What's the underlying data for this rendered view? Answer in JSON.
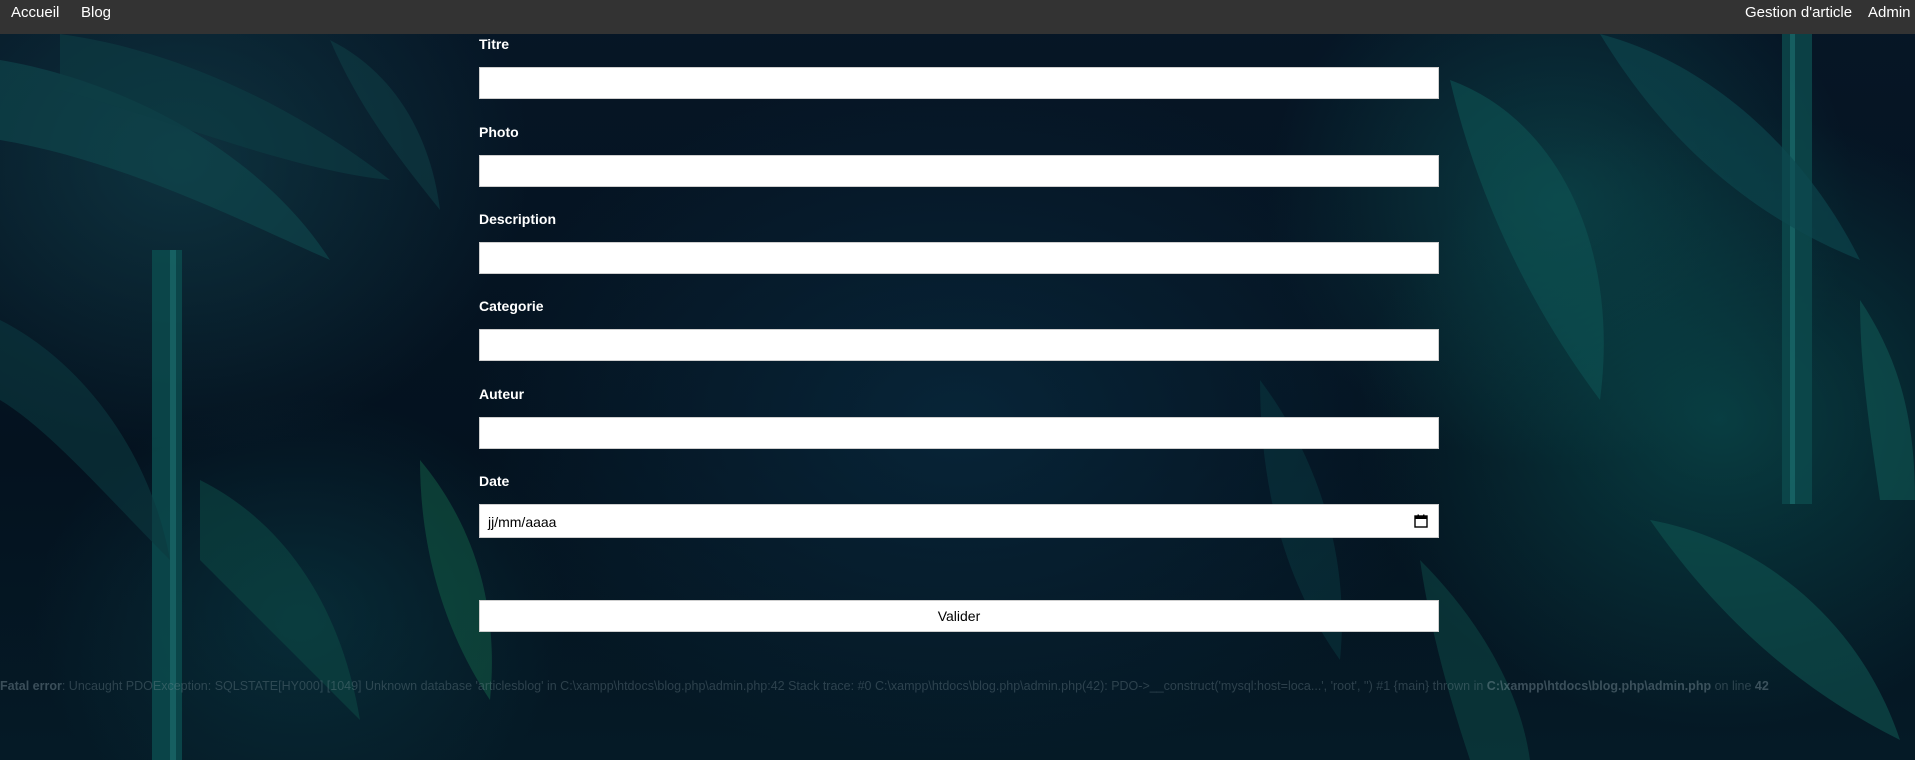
{
  "nav": {
    "left": [
      "Accueil",
      "Blog"
    ],
    "right": [
      "Gestion d'article",
      "Admin"
    ]
  },
  "form": {
    "fields": [
      {
        "label": "Titre",
        "value": ""
      },
      {
        "label": "Photo",
        "value": ""
      },
      {
        "label": "Description",
        "value": ""
      },
      {
        "label": "Categorie",
        "value": ""
      },
      {
        "label": "Auteur",
        "value": ""
      }
    ],
    "date": {
      "label": "Date",
      "placeholder": "jj/mm/aaaa"
    },
    "submit_label": "Valider"
  },
  "error": {
    "prefix": "Fatal error",
    "message": ": Uncaught PDOException: SQLSTATE[HY000] [1049] Unknown database 'articlesblog' in C:\\xampp\\htdocs\\blog.php\\admin.php:42 Stack trace: #0 C:\\xampp\\htdocs\\blog.php\\admin.php(42): PDO->__construct('mysql:host=loca...', 'root', '') #1 {main} thrown in ",
    "file": "C:\\xampp\\htdocs\\blog.php\\admin.php",
    "line_prefix": " on line ",
    "line": "42"
  }
}
